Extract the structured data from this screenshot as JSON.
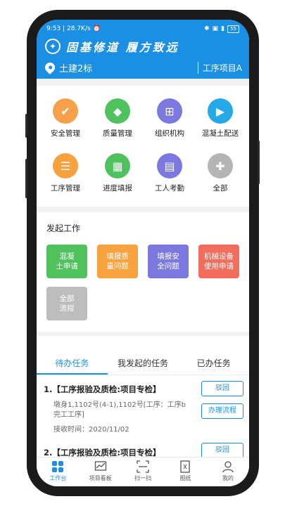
{
  "status": {
    "time": "9:53",
    "speed": "28.7K/s",
    "battery": "55"
  },
  "header": {
    "slogan": "固基修道  履方致远",
    "location": "土建2标",
    "project": "工序项目A",
    "colors": {
      "primary": "#1a8fe3"
    }
  },
  "grid": [
    {
      "label": "安全管理",
      "icon": "shield-check-icon",
      "color": "#f6a04b",
      "glyph": "✔"
    },
    {
      "label": "质量管理",
      "icon": "quality-shield-icon",
      "color": "#4fc15d",
      "glyph": "◆"
    },
    {
      "label": "组织机构",
      "icon": "org-chart-icon",
      "color": "#7b79e0",
      "glyph": "⊞"
    },
    {
      "label": "混凝土配送",
      "icon": "concrete-truck-icon",
      "color": "#25a9e8",
      "glyph": "▶"
    },
    {
      "label": "工序管理",
      "icon": "checklist-icon",
      "color": "#f7a23e",
      "glyph": "☰"
    },
    {
      "label": "进度填报",
      "icon": "calendar-progress-icon",
      "color": "#4fc15d",
      "glyph": "▦"
    },
    {
      "label": "工人考勤",
      "icon": "attendance-icon",
      "color": "#7b79e0",
      "glyph": "▤"
    },
    {
      "label": "全部",
      "icon": "all-apps-icon",
      "color": "#b4b4b4",
      "glyph": "✚"
    }
  ],
  "work": {
    "title": "发起工作",
    "buttons": [
      {
        "label": "混凝\n土申请",
        "color": "#4fc15d"
      },
      {
        "label": "填报质\n量问题",
        "color": "#f7a23e"
      },
      {
        "label": "填报安\n全问题",
        "color": "#7b79e0"
      },
      {
        "label": "机械设备\n使用申请",
        "color": "#f26d5b"
      },
      {
        "label": "全部\n流程",
        "color": "#bdbdbd"
      }
    ]
  },
  "tabs": [
    {
      "label": "待办任务",
      "active": true
    },
    {
      "label": "我发起的任务",
      "active": false
    },
    {
      "label": "已办任务",
      "active": false
    }
  ],
  "tasks": [
    {
      "title": "1.【工序报验及质检:项目专检】",
      "desc": "墩身1,1102号(4-1),1102号[工序：工序b完工工序]",
      "time": "接收时间：2020/11/02",
      "btn_return": "驳回",
      "btn_flow": "办理流程"
    },
    {
      "title": "2.【工序报验及质检:项目专检】",
      "btn_return": "驳回"
    }
  ],
  "nav": [
    {
      "label": "工作台",
      "icon": "workbench-icon",
      "active": true
    },
    {
      "label": "项目看板",
      "icon": "dashboard-chart-icon",
      "active": false
    },
    {
      "label": "扫一扫",
      "icon": "scan-icon",
      "active": false
    },
    {
      "label": "图纸",
      "icon": "drawing-icon",
      "active": false
    },
    {
      "label": "我的",
      "icon": "profile-icon",
      "active": false
    }
  ]
}
